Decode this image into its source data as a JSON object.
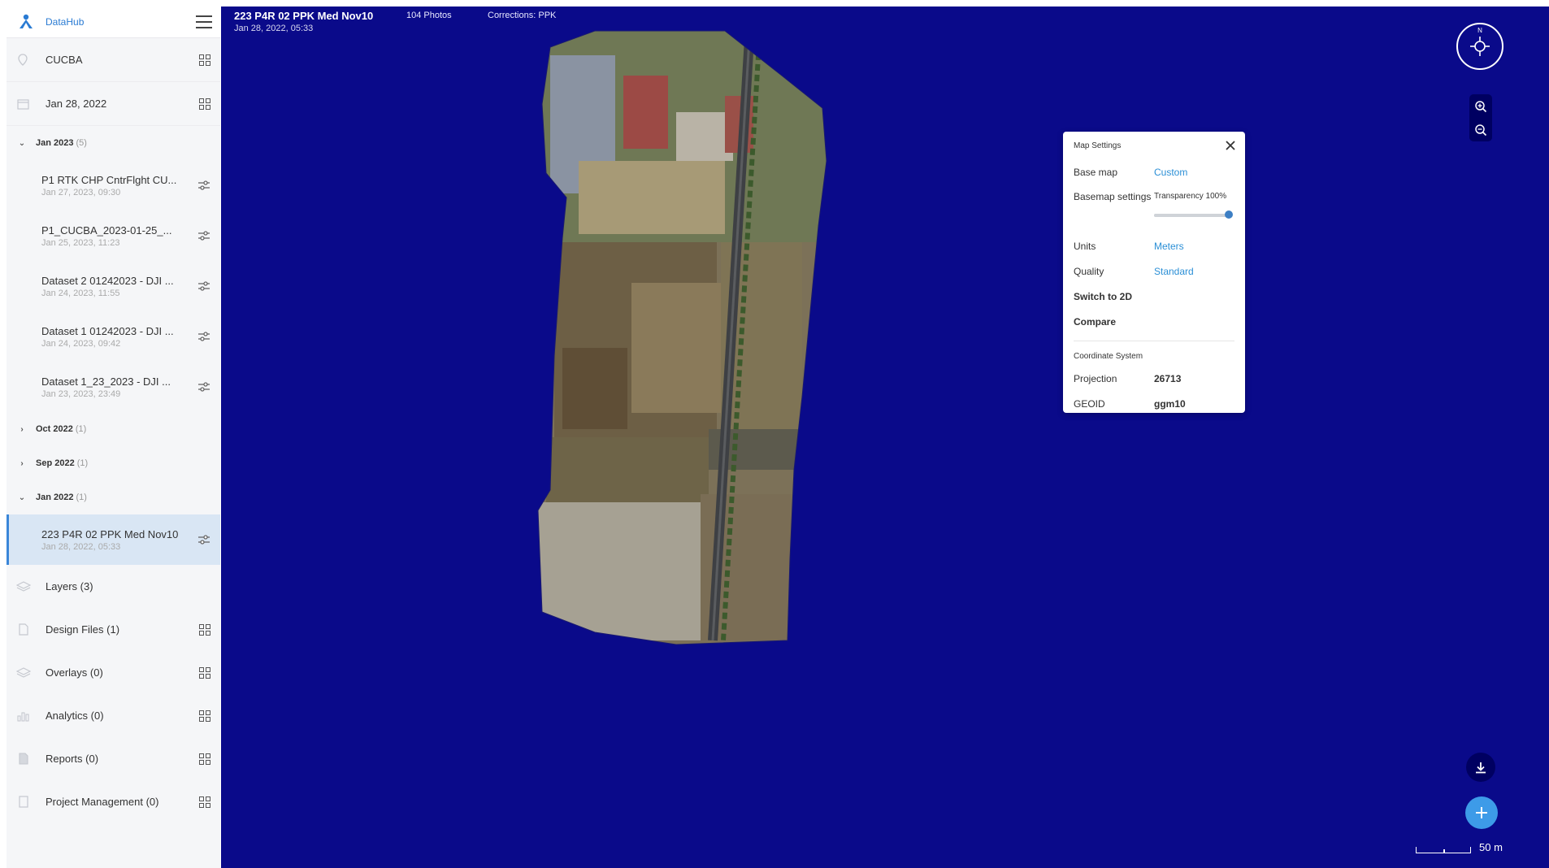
{
  "app": {
    "name": "DataHub"
  },
  "sidebar": {
    "project": {
      "label": "CUCBA",
      "icon": "pin-icon"
    },
    "date": {
      "label": "Jan 28, 2022",
      "icon": "calendar-icon"
    },
    "groups": [
      {
        "label": "Jan 2023",
        "count": "(5)",
        "expanded": true,
        "items": [
          {
            "title": "P1 RTK CHP CntrFlght CU...",
            "date": "Jan 27, 2023, 09:30"
          },
          {
            "title": "P1_CUCBA_2023-01-25_...",
            "date": "Jan 25, 2023, 11:23"
          },
          {
            "title": "Dataset 2 01242023 - DJI ...",
            "date": "Jan 24, 2023, 11:55"
          },
          {
            "title": "Dataset 1 01242023 - DJI ...",
            "date": "Jan 24, 2023, 09:42"
          },
          {
            "title": "Dataset 1_23_2023 - DJI ...",
            "date": "Jan 23, 2023, 23:49"
          }
        ]
      },
      {
        "label": "Oct 2022",
        "count": "(1)",
        "expanded": false
      },
      {
        "label": "Sep 2022",
        "count": "(1)",
        "expanded": false
      },
      {
        "label": "Jan 2022",
        "count": "(1)",
        "expanded": true,
        "items": [
          {
            "title": "223 P4R 02 PPK Med Nov10",
            "date": "Jan 28, 2022, 05:33",
            "selected": true
          }
        ]
      }
    ],
    "sections": [
      {
        "label": "Layers (3)",
        "icon": "layers-icon"
      },
      {
        "label": "Design Files (1)",
        "icon": "file-icon"
      },
      {
        "label": "Overlays (0)",
        "icon": "overlay-icon"
      },
      {
        "label": "Analytics (0)",
        "icon": "bar-chart-icon"
      },
      {
        "label": "Reports (0)",
        "icon": "report-icon"
      },
      {
        "label": "Project Management (0)",
        "icon": "clipboard-icon"
      }
    ]
  },
  "map": {
    "title": "223 P4R 02 PPK Med Nov10",
    "date": "Jan 28, 2022, 05:33",
    "photos": "104 Photos",
    "corrections": "Corrections: PPK",
    "background_color": "#0a0a8a",
    "scale_label": "50 m",
    "compass_letter": "N"
  },
  "settings": {
    "title": "Map Settings",
    "base_map_label": "Base map",
    "base_map_value": "Custom",
    "basemap_settings_label": "Basemap settings",
    "transparency_label": "Transparency 100%",
    "transparency_value": 1.0,
    "units_label": "Units",
    "units_value": "Meters",
    "quality_label": "Quality",
    "quality_value": "Standard",
    "switch_2d": "Switch to 2D",
    "compare": "Compare",
    "coord_title": "Coordinate System",
    "projection_label": "Projection",
    "projection_value": "26713",
    "geoid_label": "GEOID",
    "geoid_value": "ggm10"
  },
  "colors": {
    "accent": "#2b8fd6",
    "selected_bg": "#d9e6f4",
    "add_button": "#3d9be8"
  }
}
